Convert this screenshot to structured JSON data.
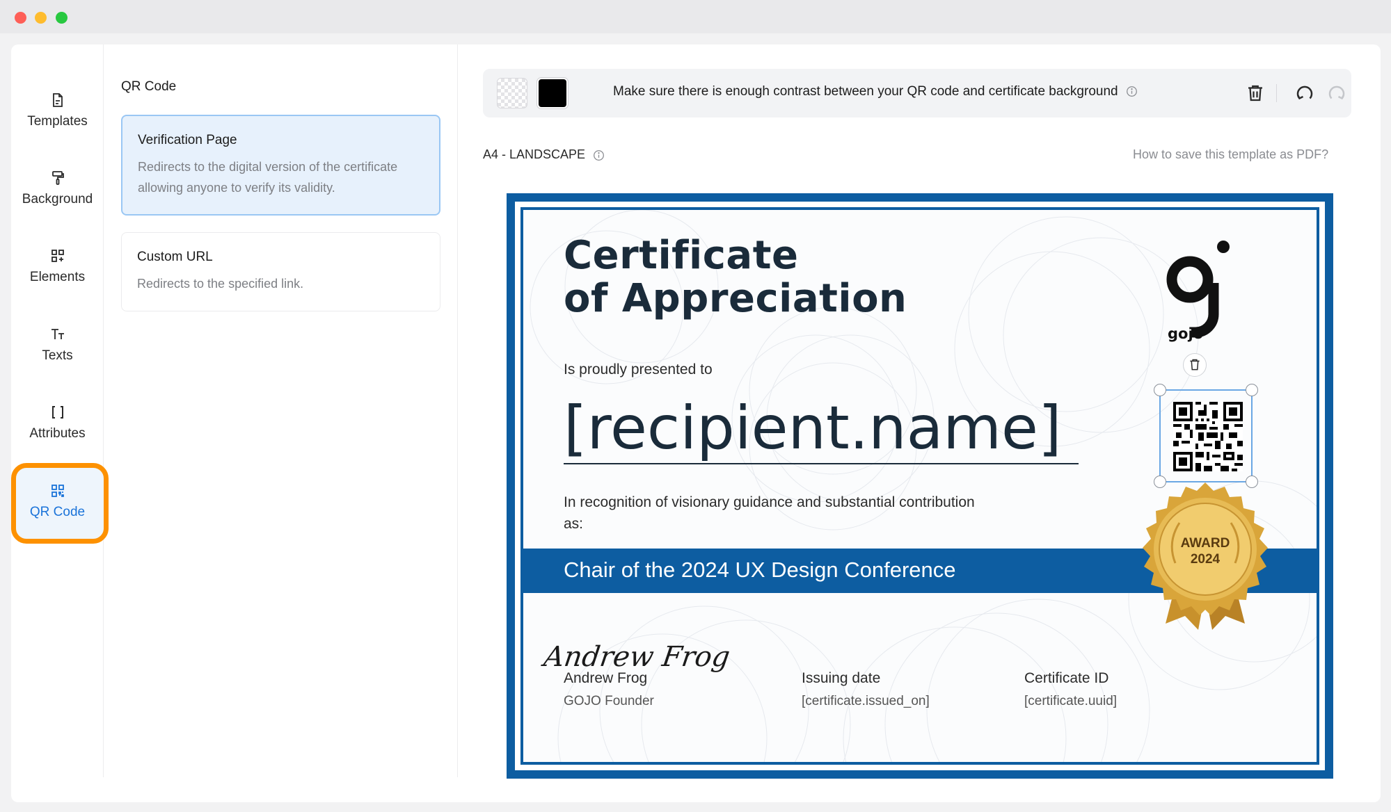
{
  "sidebar": {
    "items": [
      {
        "label": "Templates",
        "icon": "template-file-icon"
      },
      {
        "label": "Background",
        "icon": "paint-roller-icon"
      },
      {
        "label": "Elements",
        "icon": "elements-grid-icon"
      },
      {
        "label": "Texts",
        "icon": "text-icon"
      },
      {
        "label": "Attributes",
        "icon": "brackets-icon"
      },
      {
        "label": "QR Code",
        "icon": "qr-code-icon",
        "active": true
      }
    ]
  },
  "options": {
    "title": "QR Code",
    "cards": [
      {
        "title": "Verification Page",
        "description": "Redirects to the digital version of the certificate allowing anyone to verify its validity.",
        "selected": true
      },
      {
        "title": "Custom URL",
        "description": "Redirects to the specified link.",
        "selected": false
      }
    ]
  },
  "toolbar": {
    "message": "Make sure there is enough contrast between your QR code and certificate background",
    "colors": {
      "transparent": "transparent",
      "selected": "#000000"
    }
  },
  "canvas": {
    "format_label": "A4 - LANDSCAPE",
    "help_link": "How to save this template as PDF?"
  },
  "certificate": {
    "title_line1": "Certificate",
    "title_line2": "of Appreciation",
    "presented_to": "Is proudly presented to",
    "recipient_placeholder": "[recipient.name]",
    "recognition": "In recognition of visionary guidance and substantial contribution as:",
    "role": "Chair of the 2024 UX Design Conference",
    "signature": "Andrew Frog",
    "signer_name": "Andrew Frog",
    "signer_title": "GOJO Founder",
    "issuing_label": "Issuing date",
    "issuing_value": "[certificate.issued_on]",
    "id_label": "Certificate ID",
    "id_value": "[certificate.uuid]",
    "logo_text": "gojo",
    "badge_line1": "AWARD",
    "badge_line2": "2024",
    "colors": {
      "frame": "#0d5da1",
      "title": "#1a2b3a",
      "badge_gold": "#d9a53a"
    }
  },
  "colors": {
    "accent": "#1a73d9",
    "highlight": "#fd9100",
    "selected_card_bg": "#e7f1fc"
  }
}
